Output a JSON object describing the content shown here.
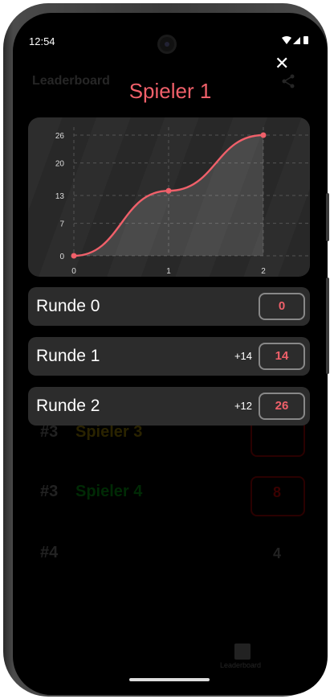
{
  "status_bar": {
    "time": "12:54",
    "icons": "▾◢▮"
  },
  "background": {
    "title": "Leaderboard",
    "share_icon": "share-icon",
    "rows": [
      {
        "rank": "#3",
        "name": "Spieler 3",
        "value": "",
        "name_color": "#2a2300"
      },
      {
        "rank": "#3",
        "name": "Spieler 4",
        "value": "8",
        "name_color": "#002a05",
        "value_color": "#3a0000"
      },
      {
        "rank": "#4",
        "name": "",
        "value": "4",
        "name_color": "#222",
        "value_color": "#222"
      }
    ],
    "bottom_tab": {
      "label": "Leaderboard",
      "icon": "leaderboard-icon"
    }
  },
  "dialog": {
    "close_icon": "close-icon",
    "title": "Spieler 1",
    "rounds": [
      {
        "label": "Runde 0",
        "delta": "",
        "score": "0"
      },
      {
        "label": "Runde 1",
        "delta": "+14",
        "score": "14"
      },
      {
        "label": "Runde 2",
        "delta": "+12",
        "score": "26"
      }
    ]
  },
  "colors": {
    "accent": "#f0606a",
    "background": "#000000",
    "card": "#2c2c2c"
  },
  "chart_data": {
    "type": "line",
    "x": [
      0,
      1,
      2
    ],
    "series": [
      {
        "values": [
          0,
          14,
          26
        ]
      }
    ],
    "x_ticks": [
      "0",
      "1",
      "2"
    ],
    "y_ticks": [
      "0",
      "7",
      "13",
      "20",
      "26"
    ],
    "xlim": [
      0,
      2
    ],
    "ylim": [
      0,
      26
    ],
    "grid": true
  }
}
